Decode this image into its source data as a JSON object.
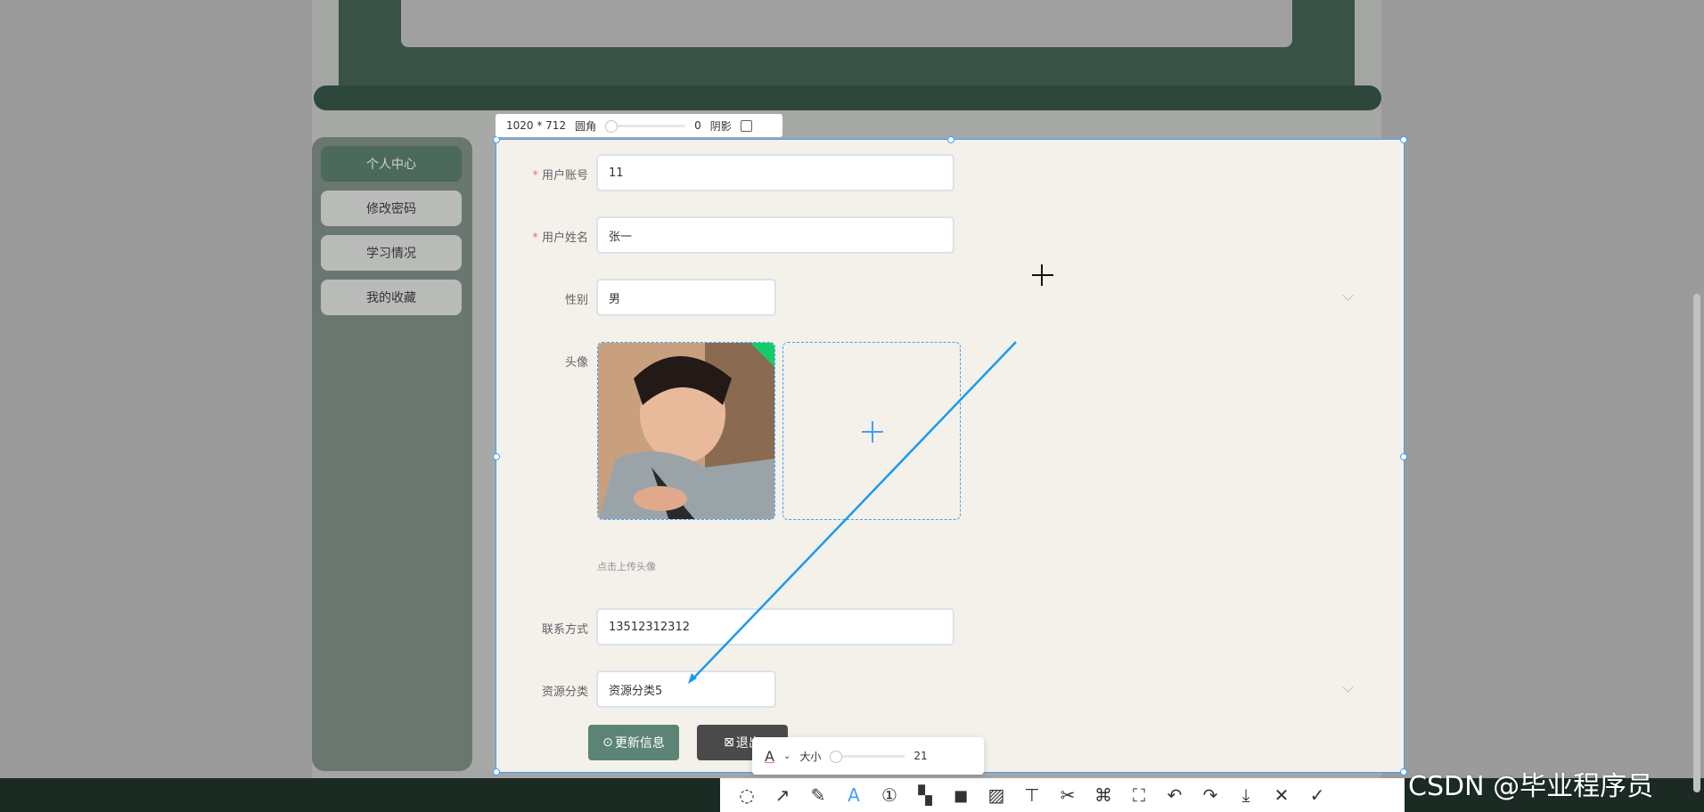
{
  "sidebar": {
    "items": [
      {
        "label": "个人中心",
        "active": true
      },
      {
        "label": "修改密码",
        "active": false
      },
      {
        "label": "学习情况",
        "active": false
      },
      {
        "label": "我的收藏",
        "active": false
      }
    ]
  },
  "form": {
    "account_label": "用户账号",
    "account_value": "11",
    "name_label": "用户姓名",
    "name_value": "张一",
    "gender_label": "性别",
    "gender_value": "男",
    "avatar_label": "头像",
    "avatar_hint": "点击上传头像",
    "phone_label": "联系方式",
    "phone_value": "13512312312",
    "category_label": "资源分类",
    "category_value": "资源分类5",
    "required_mark": "*"
  },
  "buttons": {
    "update": "更新信息",
    "logout": "退出"
  },
  "snip": {
    "dimensions": "1020 * 712",
    "radius_label": "圆角",
    "radius_value": "0",
    "shadow_label": "阴影",
    "size_label": "大小",
    "size_value": "21",
    "text_tool_glyph": "A"
  },
  "watermark": "CSDN @毕业程序员",
  "colors": {
    "accent": "#409eff",
    "sidebar_active": "#4b6a5c",
    "primary_button": "#5b8474",
    "logout_button": "#4a4a4a",
    "header": "#3a5146"
  }
}
